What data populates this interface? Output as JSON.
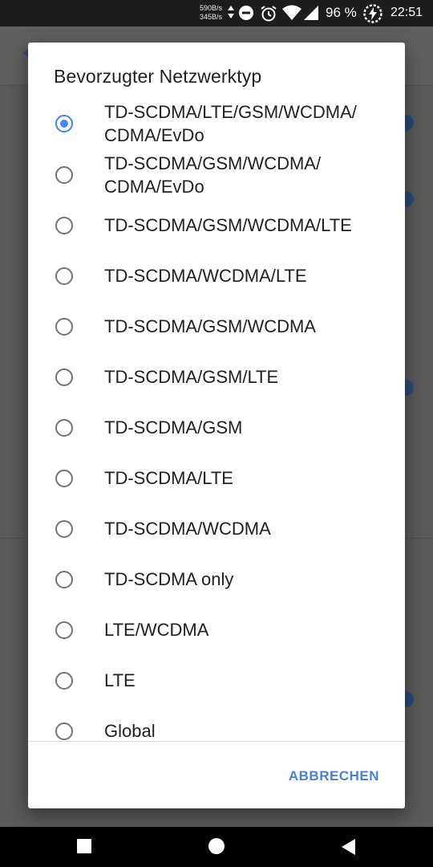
{
  "status_bar": {
    "net_up": "590B/s",
    "net_down": "345B/s",
    "battery_percent": "96 %",
    "time": "22:51",
    "icons": [
      "arrows-updown-icon",
      "do-not-disturb-icon",
      "alarm-icon",
      "wifi-icon",
      "signal-icon",
      "battery-charging-icon"
    ]
  },
  "dialog": {
    "title": "Bevorzugter Netzwerktyp",
    "options": [
      {
        "line1": "TD-SCDMA/LTE/GSM/WCDMA/",
        "line2": "CDMA/EvDo",
        "checked": true
      },
      {
        "line1": "TD-SCDMA/GSM/WCDMA/",
        "line2": "CDMA/EvDo",
        "checked": false
      },
      {
        "line1": "TD-SCDMA/GSM/WCDMA/LTE",
        "checked": false
      },
      {
        "line1": "TD-SCDMA/WCDMA/LTE",
        "checked": false
      },
      {
        "line1": "TD-SCDMA/GSM/WCDMA",
        "checked": false
      },
      {
        "line1": "TD-SCDMA/GSM/LTE",
        "checked": false
      },
      {
        "line1": "TD-SCDMA/GSM",
        "checked": false
      },
      {
        "line1": "TD-SCDMA/LTE",
        "checked": false
      },
      {
        "line1": "TD-SCDMA/WCDMA",
        "checked": false
      },
      {
        "line1": "TD-SCDMA only",
        "checked": false
      },
      {
        "line1": "LTE/WCDMA",
        "checked": false
      },
      {
        "line1": "LTE",
        "checked": false
      },
      {
        "line1": "Global",
        "checked": false
      }
    ],
    "cancel_label": "ABBRECHEN"
  },
  "colors": {
    "accent": "#4285f4",
    "button_text": "#4a7fd8",
    "scrim": "#5a5a5a"
  },
  "nav_bar": {
    "icons": [
      "recents-square-icon",
      "home-circle-icon",
      "back-triangle-icon"
    ]
  }
}
